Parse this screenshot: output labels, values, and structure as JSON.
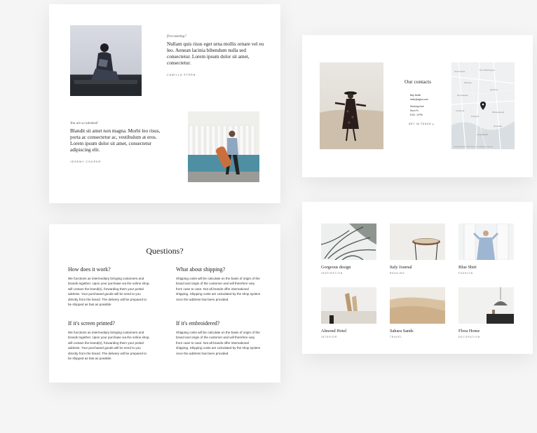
{
  "testimonials": {
    "first": {
      "intro": "first meeting?",
      "quote": "Nullam quis risus eget urna mollis ornare vel eu leo. Aenean lacinia bibendum nulla sed consectetur. Lorem ipsum dolor sit amet, consectetur.",
      "author": "CAMILLA STERN"
    },
    "second": {
      "intro": "You are so talented!",
      "quote": "Blandit sit amet non magna. Morbi leo risus, porta ac consectetur ac, vestibulum at eros. Lorem ipsum dolor sit amet, consectetur adipiscing elit.",
      "author": "JEREMY COOPER"
    }
  },
  "contacts": {
    "title": "Our contacts",
    "phone": "Bay Nellie",
    "email": "hello@agius.com",
    "hours_label": "Working time",
    "days": "Mon-Fri",
    "time": "8:00 - 6:PM",
    "link": "GET IN TOUCH",
    "map_caption": "Google  Map data ©2020  Terms of Use  Report a map error",
    "map_labels": [
      "Harrison",
      "Hempstead",
      "Mineola",
      "Freeport",
      "Lynbrook",
      "Massapequa",
      "Port Washington",
      "Great Neck",
      "Rockville",
      "Long Beach"
    ]
  },
  "faq": {
    "title": "Questions?",
    "items": [
      {
        "q": "How does it work?",
        "a": "We functions as intermediary bringing customers and brands together. Upon your purchase via the online shop, will contact the brand(s), forwarding them your postal address. Your purchased goods will be send to you directly from the brand. The delivery will be prepared to be shipped as fast as possible"
      },
      {
        "q": "What about shipping?",
        "a": "Shipping costs will be calculate on the basis of origin of the brand and origin of the customer and will therefore vary from case to case. Not all brands offer international shipping. Shipping costs are calculated by the shop system once the address has been provided."
      },
      {
        "q": "If it's screen printed?",
        "a": "We functions as intermediary bringing customers and brands together. Upon your purchase via the online shop, will contact the brand(s), forwarding them your postal address. Your purchased goods will be send to you directly from the brand. The delivery will be prepared to be shipped as fast as possible"
      },
      {
        "q": "If it's embroidered?",
        "a": "Shipping costs will be calculate on the basis of origin of the brand and origin of the customer and will therefore vary from case to case. Not all brands offer international shipping. Shipping costs are calculated by the shop system once the address has been provided."
      }
    ]
  },
  "gallery": {
    "items": [
      {
        "title": "Gorgeous design",
        "tag": "INSPIRATION"
      },
      {
        "title": "Italy Journal",
        "tag": "READING"
      },
      {
        "title": "Blue Shirt",
        "tag": "FASHION"
      },
      {
        "title": "Almond Hotel",
        "tag": "INTERIOR"
      },
      {
        "title": "Sahara Sands",
        "tag": "TRAVEL"
      },
      {
        "title": "Flora Home",
        "tag": "DECORATION"
      }
    ]
  }
}
